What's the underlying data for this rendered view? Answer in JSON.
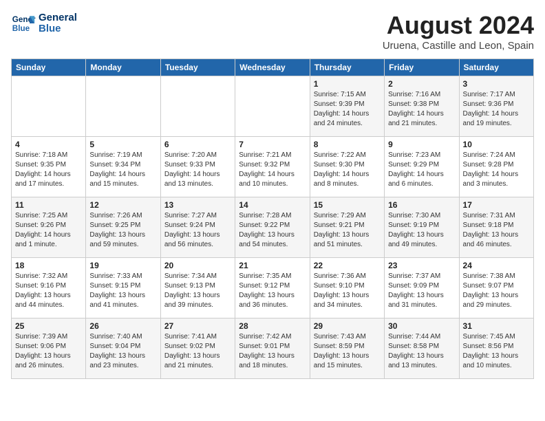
{
  "header": {
    "logo_line1": "General",
    "logo_line2": "Blue",
    "month_year": "August 2024",
    "location": "Uruena, Castille and Leon, Spain"
  },
  "days_of_week": [
    "Sunday",
    "Monday",
    "Tuesday",
    "Wednesday",
    "Thursday",
    "Friday",
    "Saturday"
  ],
  "weeks": [
    [
      {
        "day": "",
        "content": ""
      },
      {
        "day": "",
        "content": ""
      },
      {
        "day": "",
        "content": ""
      },
      {
        "day": "",
        "content": ""
      },
      {
        "day": "1",
        "content": "Sunrise: 7:15 AM\nSunset: 9:39 PM\nDaylight: 14 hours\nand 24 minutes."
      },
      {
        "day": "2",
        "content": "Sunrise: 7:16 AM\nSunset: 9:38 PM\nDaylight: 14 hours\nand 21 minutes."
      },
      {
        "day": "3",
        "content": "Sunrise: 7:17 AM\nSunset: 9:36 PM\nDaylight: 14 hours\nand 19 minutes."
      }
    ],
    [
      {
        "day": "4",
        "content": "Sunrise: 7:18 AM\nSunset: 9:35 PM\nDaylight: 14 hours\nand 17 minutes."
      },
      {
        "day": "5",
        "content": "Sunrise: 7:19 AM\nSunset: 9:34 PM\nDaylight: 14 hours\nand 15 minutes."
      },
      {
        "day": "6",
        "content": "Sunrise: 7:20 AM\nSunset: 9:33 PM\nDaylight: 14 hours\nand 13 minutes."
      },
      {
        "day": "7",
        "content": "Sunrise: 7:21 AM\nSunset: 9:32 PM\nDaylight: 14 hours\nand 10 minutes."
      },
      {
        "day": "8",
        "content": "Sunrise: 7:22 AM\nSunset: 9:30 PM\nDaylight: 14 hours\nand 8 minutes."
      },
      {
        "day": "9",
        "content": "Sunrise: 7:23 AM\nSunset: 9:29 PM\nDaylight: 14 hours\nand 6 minutes."
      },
      {
        "day": "10",
        "content": "Sunrise: 7:24 AM\nSunset: 9:28 PM\nDaylight: 14 hours\nand 3 minutes."
      }
    ],
    [
      {
        "day": "11",
        "content": "Sunrise: 7:25 AM\nSunset: 9:26 PM\nDaylight: 14 hours\nand 1 minute."
      },
      {
        "day": "12",
        "content": "Sunrise: 7:26 AM\nSunset: 9:25 PM\nDaylight: 13 hours\nand 59 minutes."
      },
      {
        "day": "13",
        "content": "Sunrise: 7:27 AM\nSunset: 9:24 PM\nDaylight: 13 hours\nand 56 minutes."
      },
      {
        "day": "14",
        "content": "Sunrise: 7:28 AM\nSunset: 9:22 PM\nDaylight: 13 hours\nand 54 minutes."
      },
      {
        "day": "15",
        "content": "Sunrise: 7:29 AM\nSunset: 9:21 PM\nDaylight: 13 hours\nand 51 minutes."
      },
      {
        "day": "16",
        "content": "Sunrise: 7:30 AM\nSunset: 9:19 PM\nDaylight: 13 hours\nand 49 minutes."
      },
      {
        "day": "17",
        "content": "Sunrise: 7:31 AM\nSunset: 9:18 PM\nDaylight: 13 hours\nand 46 minutes."
      }
    ],
    [
      {
        "day": "18",
        "content": "Sunrise: 7:32 AM\nSunset: 9:16 PM\nDaylight: 13 hours\nand 44 minutes."
      },
      {
        "day": "19",
        "content": "Sunrise: 7:33 AM\nSunset: 9:15 PM\nDaylight: 13 hours\nand 41 minutes."
      },
      {
        "day": "20",
        "content": "Sunrise: 7:34 AM\nSunset: 9:13 PM\nDaylight: 13 hours\nand 39 minutes."
      },
      {
        "day": "21",
        "content": "Sunrise: 7:35 AM\nSunset: 9:12 PM\nDaylight: 13 hours\nand 36 minutes."
      },
      {
        "day": "22",
        "content": "Sunrise: 7:36 AM\nSunset: 9:10 PM\nDaylight: 13 hours\nand 34 minutes."
      },
      {
        "day": "23",
        "content": "Sunrise: 7:37 AM\nSunset: 9:09 PM\nDaylight: 13 hours\nand 31 minutes."
      },
      {
        "day": "24",
        "content": "Sunrise: 7:38 AM\nSunset: 9:07 PM\nDaylight: 13 hours\nand 29 minutes."
      }
    ],
    [
      {
        "day": "25",
        "content": "Sunrise: 7:39 AM\nSunset: 9:06 PM\nDaylight: 13 hours\nand 26 minutes."
      },
      {
        "day": "26",
        "content": "Sunrise: 7:40 AM\nSunset: 9:04 PM\nDaylight: 13 hours\nand 23 minutes."
      },
      {
        "day": "27",
        "content": "Sunrise: 7:41 AM\nSunset: 9:02 PM\nDaylight: 13 hours\nand 21 minutes."
      },
      {
        "day": "28",
        "content": "Sunrise: 7:42 AM\nSunset: 9:01 PM\nDaylight: 13 hours\nand 18 minutes."
      },
      {
        "day": "29",
        "content": "Sunrise: 7:43 AM\nSunset: 8:59 PM\nDaylight: 13 hours\nand 15 minutes."
      },
      {
        "day": "30",
        "content": "Sunrise: 7:44 AM\nSunset: 8:58 PM\nDaylight: 13 hours\nand 13 minutes."
      },
      {
        "day": "31",
        "content": "Sunrise: 7:45 AM\nSunset: 8:56 PM\nDaylight: 13 hours\nand 10 minutes."
      }
    ]
  ]
}
